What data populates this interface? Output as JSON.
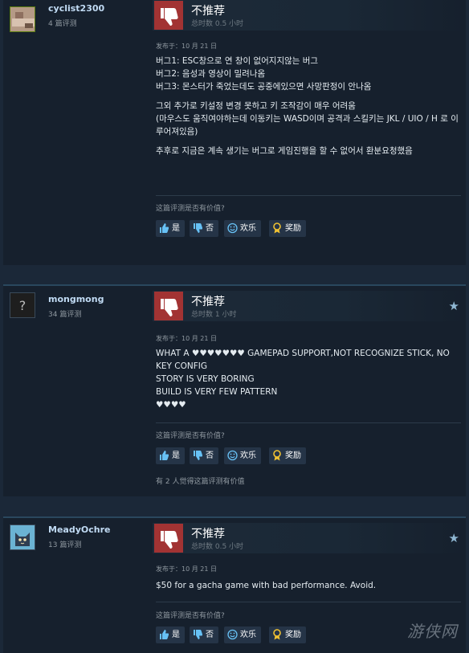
{
  "labels": {
    "not_recommended": "不推荐",
    "posted_prefix": "发布于：",
    "helpful_question": "这篇评测是否有价值?",
    "btn_yes": "是",
    "btn_no": "否",
    "btn_funny": "欢乐",
    "btn_award": "奖励"
  },
  "reviews": [
    {
      "author": "cyclist2300",
      "review_count": "4 篇评测",
      "verdict": "不推荐",
      "hours": "总时数 0.5 小时",
      "posted": "发布于：10 月 21 日",
      "paragraphs": [
        "버그1: ESC창으로 연 창이 없어지지않는 버그\n버그2: 음성과 영상이 밀려나옴\n버그3: 몬스터가 죽었는데도 공중에있으면 사망판정이 안나옴",
        "그외 추가로 키설정 변경 못하고 키 조작감이 매우 어려움\n(마우스도 움직여야하는데 이동키는 WASD이며 공격과 스킬키는 JKL / UIO / H 로 이루어져있음)",
        "추후로 지금은 계속 생기는 버그로 게임진행을 할 수 없어서 환분요청했음"
      ],
      "helpful_text": ""
    },
    {
      "author": "mongmong",
      "review_count": "34 篇评测",
      "verdict": "不推荐",
      "hours": "总时数 1 小时",
      "posted": "发布于：10 月 21 日",
      "paragraphs": [
        "WHAT A ♥♥♥♥♥♥♥ GAMEPAD SUPPORT,NOT RECOGNIZE STICK, NO KEY CONFIG\nSTORY IS VERY BORING\nBUILD IS VERY FEW PATTERN\n♥♥♥♥"
      ],
      "helpful_text": "有 2 人觉得这篇评测有价值"
    },
    {
      "author": "MeadyOchre",
      "review_count": "13 篇评测",
      "verdict": "不推荐",
      "hours": "总时数 0.5 小时",
      "posted": "发布于：10 月 21 日",
      "paragraphs": [
        "$50 for a gacha game with bad performance. Avoid."
      ],
      "helpful_text": ""
    }
  ],
  "watermark": "游侠网",
  "colors": {
    "page_bg": "#1b2838",
    "card_bg": "#16202d",
    "thumb_red": "#a23333",
    "username": "#c1dbf4",
    "button_bg": "#253447"
  }
}
